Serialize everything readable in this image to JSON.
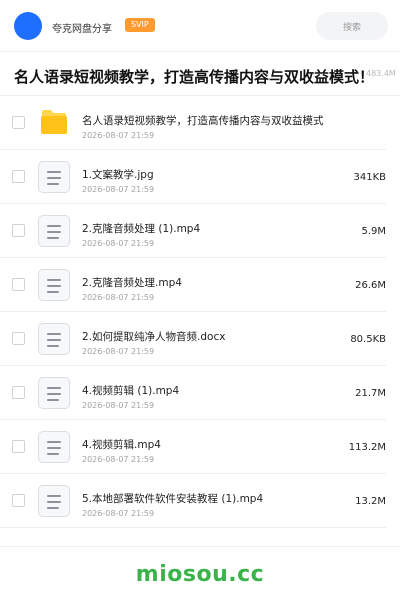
{
  "header": {
    "app_name": "夸克网盘分享",
    "badge": "SVIP",
    "search_placeholder": "搜索"
  },
  "share": {
    "title": "名人语录短视频教学，打造高传播内容与双收益模式！",
    "total_size": "483.4M"
  },
  "files": [
    {
      "type": "folder",
      "name": "名人语录短视频教学，打造高传播内容与双收益模式",
      "date": "2026-08-07 21:59",
      "size": ""
    },
    {
      "type": "file",
      "name": "1.文案教学.jpg",
      "date": "2026-08-07 21:59",
      "size": "341KB"
    },
    {
      "type": "file",
      "name": "2.克隆音频处理 (1).mp4",
      "date": "2026-08-07 21:59",
      "size": "5.9M"
    },
    {
      "type": "file",
      "name": "2.克隆音频处理.mp4",
      "date": "2026-08-07 21:59",
      "size": "26.6M"
    },
    {
      "type": "file",
      "name": "2.如何提取纯净人物音频.docx",
      "date": "2026-08-07 21:59",
      "size": "80.5KB"
    },
    {
      "type": "file",
      "name": "4.视频剪辑 (1).mp4",
      "date": "2026-08-07 21:59",
      "size": "21.7M"
    },
    {
      "type": "file",
      "name": "4.视频剪辑.mp4",
      "date": "2026-08-07 21:59",
      "size": "113.2M"
    },
    {
      "type": "file",
      "name": "5.本地部署软件软件安装教程 (1).mp4",
      "date": "2026-08-07 21:59",
      "size": "13.2M"
    }
  ],
  "watermark": "miosou.cc",
  "colors": {
    "avatar": "#1e6fff",
    "svip_badge": "#ff9a2e",
    "folder": "#ffc21a",
    "watermark": "#3bb34a"
  },
  "icons": {
    "folder": "folder-icon",
    "file": "document-icon"
  }
}
